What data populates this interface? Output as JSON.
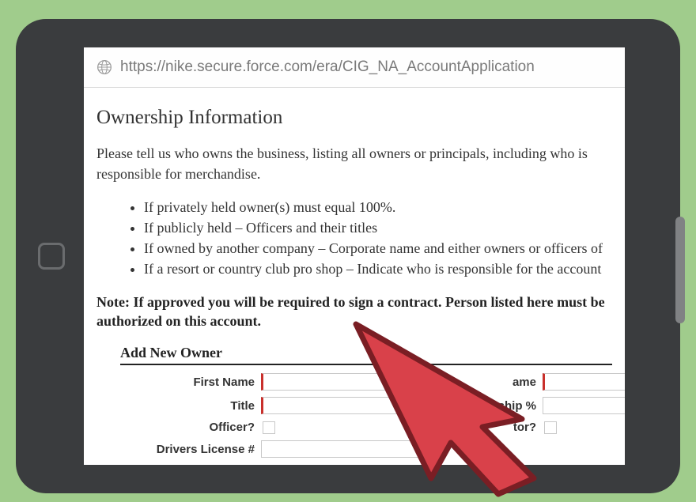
{
  "url": "https://nike.secure.force.com/era/CIG_NA_AccountApplication",
  "page": {
    "heading": "Ownership Information",
    "intro": "Please tell us who owns the business, listing all owners or principals, including who is responsible for merchandise.",
    "bullets": [
      "If privately held owner(s) must equal 100%.",
      "If publicly held – Officers and their titles",
      "If owned by another company – Corporate name and either owners or officers of",
      "If a resort or country club pro shop – Indicate who is responsible for the account"
    ],
    "note": "Note: If approved you will be required to sign a contract. Person listed here must be authorized on this account.",
    "subheading": "Add New Owner",
    "fields": {
      "first_name": "First Name",
      "last_name_suffix": "ame",
      "title": "Title",
      "ownership_suffix": "ership %",
      "officer": "Officer?",
      "director_suffix": "tor?",
      "drivers_license": "Drivers License #"
    }
  }
}
